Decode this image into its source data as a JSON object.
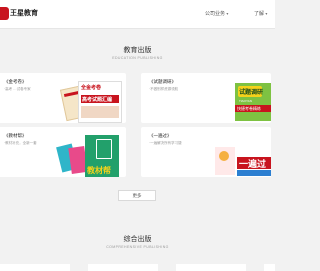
{
  "header": {
    "logo_text": "王星教育",
    "nav": [
      "公司业务",
      "了解"
    ]
  },
  "sections": [
    {
      "title": "教育出版",
      "subtitle": "EDUCATION PUBLISHING",
      "cards": [
        {
          "title": "《金考卷》",
          "desc": "·高考 …试卷专家"
        },
        {
          "title": "《试题调研》",
          "desc": "·不做别样资源领航"
        },
        {
          "title": "《教材帮》",
          "desc": "·教材补充，全新一套"
        },
        {
          "title": "《一遍过》",
          "desc": "·一遍解决所有学习疑"
        }
      ],
      "cover_text": {
        "c1_top": "全金考卷",
        "c1_main": "高考试题汇编",
        "c2_top": "试题调研",
        "c2_sub": "TIAOYAN",
        "c2_strip": "快捷考卷精练",
        "c3_main": "教材帮",
        "c4_main": "一遍过"
      },
      "more_label": "更多"
    },
    {
      "title": "综合出版",
      "subtitle": "COMPREHENSIVE PUBLISHING"
    }
  ],
  "colors": {
    "brand_red": "#c8141e",
    "page_bg": "#f2f2f2",
    "card_bg": "#ffffff"
  }
}
